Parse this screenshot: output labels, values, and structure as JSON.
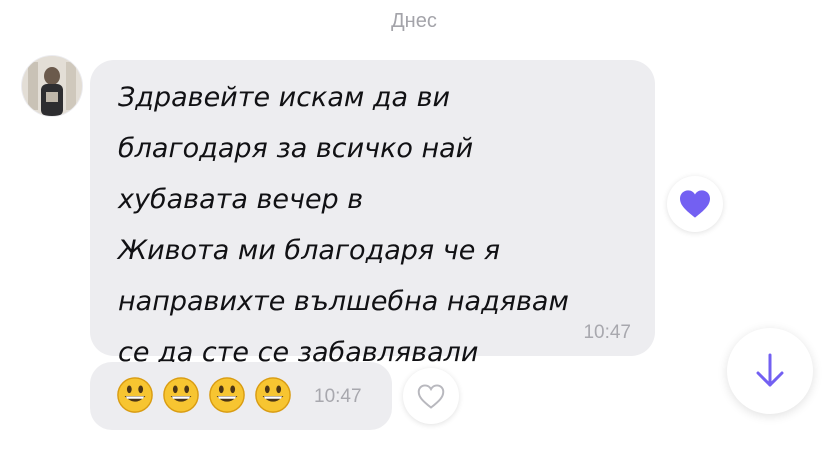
{
  "date_separator": "Днес",
  "messages": [
    {
      "text": "Здравейте искам да ви\nблагодаря за всичко най\nхубавата вечер в\nЖивота ми благодаря че я\nнаправихте вълшебна надявам\nсе да сте се забавлявали",
      "time": "10:47",
      "reaction": "heart-filled"
    },
    {
      "emoji": [
        "😀",
        "😀",
        "😀",
        "😀"
      ],
      "time": "10:47"
    }
  ],
  "colors": {
    "bubble": "#ededf0",
    "accent": "#7360f2",
    "time_text": "#a8a8ae",
    "date_text": "#a4a4aa"
  },
  "icons": {
    "reaction": "heart-filled-icon",
    "like": "heart-outline-icon",
    "scroll": "arrow-down-icon",
    "avatar": "contact-avatar"
  }
}
